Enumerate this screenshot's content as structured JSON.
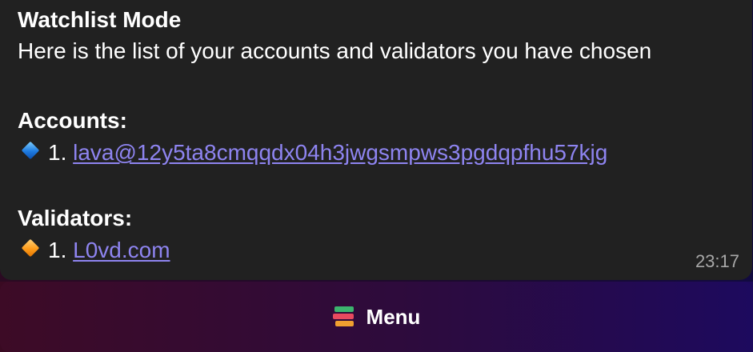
{
  "message": {
    "title": "Watchlist Mode",
    "description": "Here is the list of your accounts and validators you have chosen",
    "accounts_heading": "Accounts:",
    "accounts": [
      {
        "index": "1.",
        "address": "lava@12y5ta8cmqqdx04h3jwgsmpws3pgdqpfhu57kjg",
        "icon": "blue-diamond-icon"
      }
    ],
    "validators_heading": "Validators:",
    "validators": [
      {
        "index": "1.",
        "name": "L0vd.com",
        "icon": "orange-diamond-icon"
      }
    ],
    "time": "23:17"
  },
  "keyboard": {
    "menu_label": "Menu",
    "menu_icon": "books-icon"
  },
  "colors": {
    "bubble_bg": "#212121",
    "link": "#8e84f0",
    "text": "#ffffff",
    "time": "#a8a8a8"
  }
}
